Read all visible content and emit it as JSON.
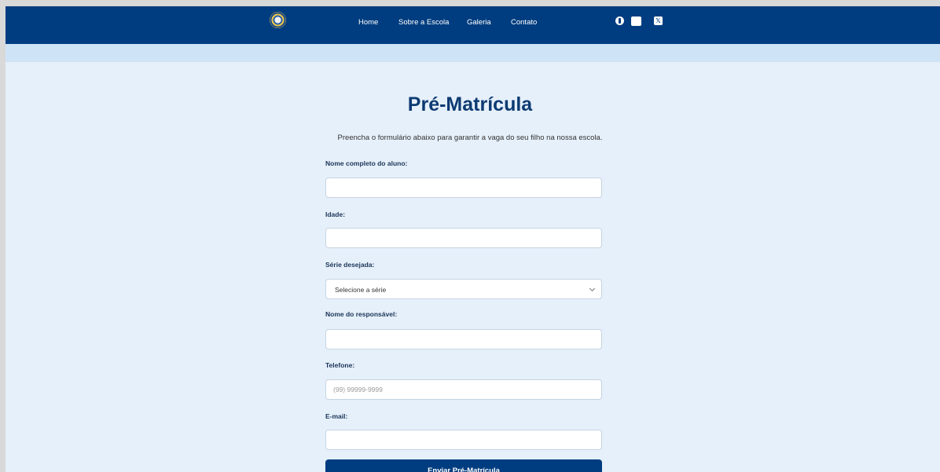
{
  "header": {
    "nav": [
      "Home",
      "Sobre a Escola",
      "Galeria",
      "Contato"
    ],
    "social_icons": [
      "facebook-icon",
      "instagram-icon",
      "x-icon"
    ],
    "x_glyph": "𝕏"
  },
  "main": {
    "title": "Pré-Matrícula",
    "intro": "Preencha o formulário abaixo para garantir a vaga do seu filho na nossa escola.",
    "fields": {
      "nome_aluno": {
        "label": "Nome completo do aluno:",
        "value": "",
        "placeholder": ""
      },
      "idade": {
        "label": "Idade:",
        "value": "",
        "placeholder": ""
      },
      "serie": {
        "label": "Série desejada:",
        "selected": "Selecione a série"
      },
      "responsavel": {
        "label": "Nome do responsável:",
        "value": "",
        "placeholder": ""
      },
      "telefone": {
        "label": "Telefone:",
        "value": "",
        "placeholder": "(99) 99999-9999"
      },
      "email": {
        "label": "E-mail:",
        "value": "",
        "placeholder": ""
      }
    },
    "submit_label": "Enviar Pré-Matrícula"
  },
  "colors": {
    "header_bg": "#003d80",
    "subband_bg": "#cfe3f6",
    "page_bg": "#e6f0fa",
    "title": "#0d3a72",
    "button_bg": "#003d80"
  }
}
